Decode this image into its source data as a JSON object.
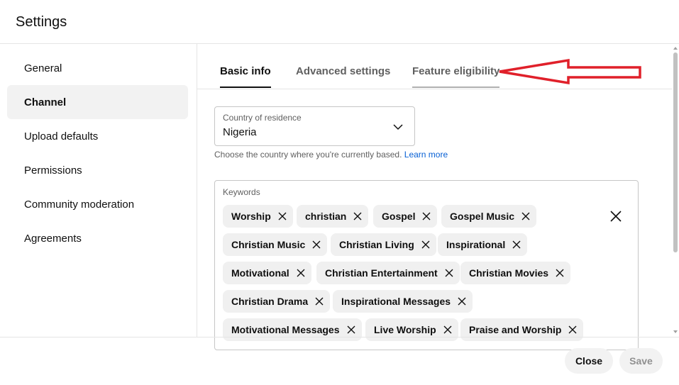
{
  "dialog": {
    "title": "Settings"
  },
  "nav": {
    "items": [
      {
        "label": "General",
        "active": false
      },
      {
        "label": "Channel",
        "active": true
      },
      {
        "label": "Upload defaults",
        "active": false
      },
      {
        "label": "Permissions",
        "active": false
      },
      {
        "label": "Community moderation",
        "active": false
      },
      {
        "label": "Agreements",
        "active": false
      }
    ]
  },
  "tabs": [
    {
      "label": "Basic info",
      "active": true
    },
    {
      "label": "Advanced settings",
      "active": false
    },
    {
      "label": "Feature eligibility",
      "active": false
    }
  ],
  "country": {
    "label": "Country of residence",
    "value": "Nigeria",
    "helper": "Choose the country where you're currently based.",
    "learn_more": "Learn more"
  },
  "keywords": {
    "label": "Keywords",
    "chips": [
      "Worship",
      "christian",
      "Gospel",
      "Gospel Music",
      "Christian Music",
      "Christian Living",
      "Inspirational",
      "Motivational",
      "Christian Entertainment",
      "Christian Movies",
      "Christian Drama",
      "Inspirational Messages",
      "Motivational Messages",
      "Live Worship",
      "Praise and Worship"
    ]
  },
  "footer": {
    "close_label": "Close",
    "save_label": "Save"
  },
  "annotation": {
    "arrow_color": "#e0202a"
  },
  "icons": {
    "chip_remove": "close-icon",
    "clear_all": "close-icon",
    "dropdown": "chevron-down-icon"
  }
}
